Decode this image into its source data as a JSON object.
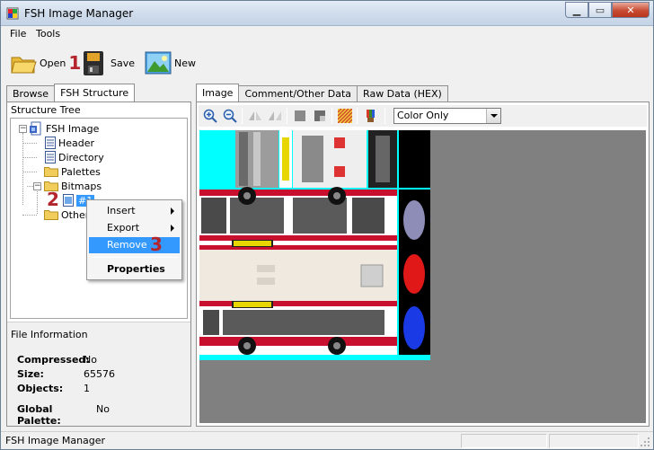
{
  "window": {
    "title": "FSH Image Manager"
  },
  "menu": {
    "file": "File",
    "tools": "Tools"
  },
  "toolbar": {
    "open_label": "Open",
    "open_step": "1",
    "save_label": "Save",
    "new_label": "New"
  },
  "left_tabs": {
    "browse": "Browse",
    "fsh_structure": "FSH Structure"
  },
  "structure": {
    "heading": "Structure Tree",
    "root": "FSH Image",
    "header": "Header",
    "directory": "Directory",
    "palettes": "Palettes",
    "bitmaps": "Bitmaps",
    "bitmap_1": "#1",
    "bitmap_step": "2",
    "other": "Other"
  },
  "context_menu": {
    "insert": "Insert",
    "export": "Export",
    "remove": "Remove",
    "remove_step": "3",
    "properties": "Properties"
  },
  "file_info": {
    "heading": "File Information",
    "compressed_label": "Compressed:",
    "compressed_value": "No",
    "size_label": "Size:",
    "size_value": "65576",
    "objects_label": "Objects:",
    "objects_value": "1",
    "global_palette_label": "Global Palette:",
    "global_palette_value": "No"
  },
  "right_tabs": {
    "image": "Image",
    "comment": "Comment/Other Data",
    "raw": "Raw Data (HEX)"
  },
  "image_toolbar": {
    "color_mode": "Color Only"
  },
  "status": {
    "text": "FSH Image Manager"
  },
  "icons": [
    "app-icon",
    "open-folder-icon",
    "save-disk-icon",
    "new-image-icon",
    "folder-icon",
    "document-icon",
    "zoom-in-icon",
    "zoom-out-icon",
    "flip-icon",
    "square-icon",
    "checker-icon",
    "brush-icon"
  ],
  "colors": {
    "selection": "#3399ff",
    "step_number": "#b3242d",
    "canvas_bg": "#808080",
    "texture_cyan": "#00ffff"
  }
}
